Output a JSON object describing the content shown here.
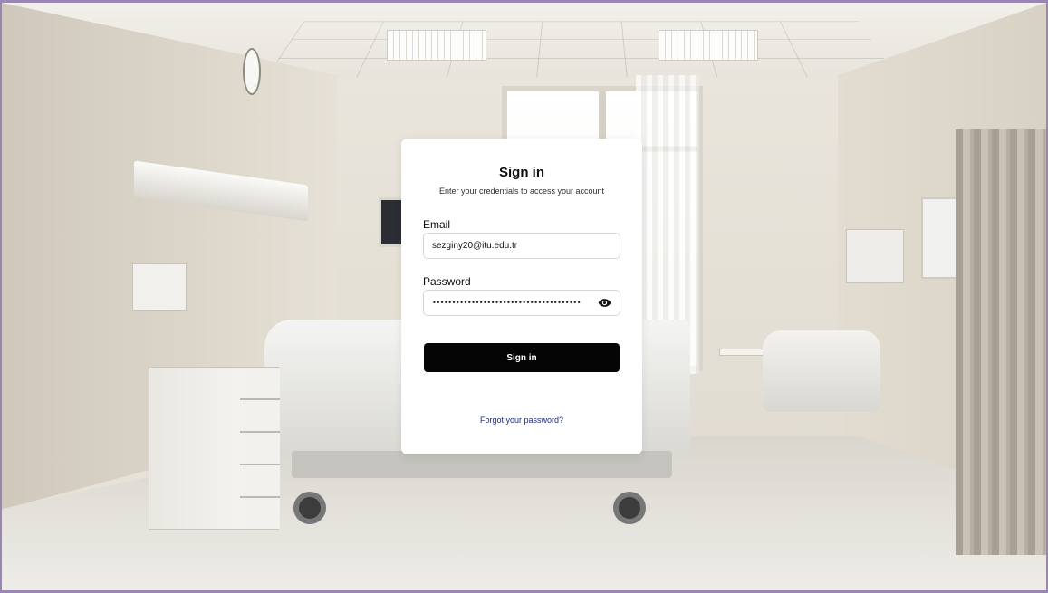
{
  "signin": {
    "title": "Sign in",
    "subtitle": "Enter your credentials to access your account",
    "email_label": "Email",
    "email_value": "sezginy20@itu.edu.tr",
    "password_label": "Password",
    "password_masked": "••••••••••••••••••••••••••••••••••••••",
    "password_toggle_icon": "eye-icon",
    "submit_label": "Sign in",
    "forgot_label": "Forgot your password?"
  },
  "colors": {
    "frame_border": "#9a86b3",
    "button_bg": "#050505",
    "link": "#1b2a7a"
  }
}
